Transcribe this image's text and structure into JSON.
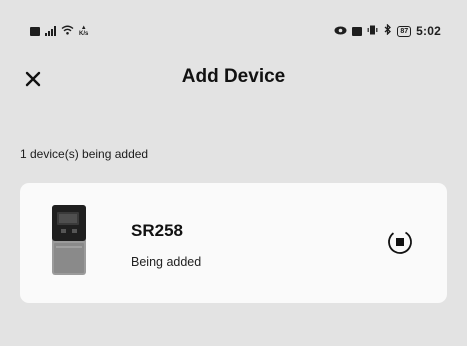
{
  "status_bar": {
    "left_icons": [
      "sim-icon",
      "signal-icon",
      "wifi-icon",
      "network-speed-icon"
    ],
    "speed_text": "K/s",
    "right_icons": [
      "eye-icon",
      "nfc-icon",
      "vibrate-icon",
      "bluetooth-icon",
      "battery-icon"
    ],
    "battery_level": "87",
    "time": "5:02"
  },
  "header": {
    "close_icon": "close-icon",
    "title": "Add Device"
  },
  "progress_text": "1 device(s) being added",
  "device": {
    "image_icon": "solar-controller-icon",
    "name": "SR258",
    "status": "Being added",
    "status_icon": "loading-spinner-icon"
  },
  "colors": {
    "background": "#e3e3e3",
    "card": "#fafafa",
    "text": "#151515"
  }
}
